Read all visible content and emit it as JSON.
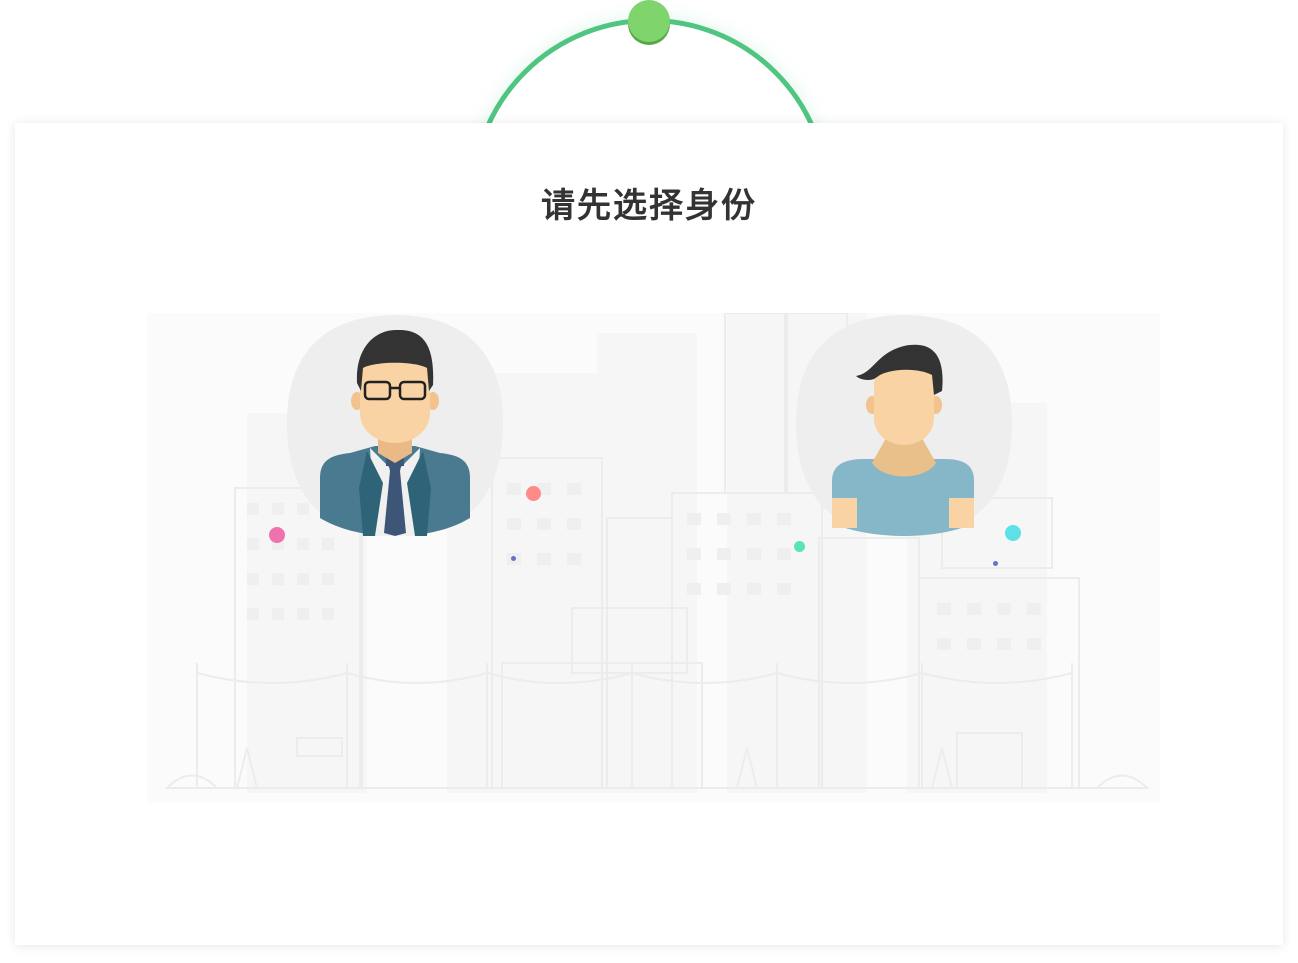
{
  "header": {
    "title": "请先选择身份"
  },
  "roles": [
    {
      "icon": "businessman-avatar-icon"
    },
    {
      "icon": "casual-man-avatar-icon"
    }
  ],
  "colors": {
    "accent_green": "#4fc581",
    "knob_green": "#7fd46c",
    "title_text": "#333333",
    "avatar_bg": "#eeeeee",
    "skin": "#f9d3a4",
    "hair": "#333333",
    "suit": "#4a7a90",
    "shirt_blue": "#86b7c8",
    "dot_pink": "#ef72ad",
    "dot_coral": "#ff8a8a",
    "dot_mint": "#59e4b7",
    "dot_cyan": "#5ee0e6",
    "dot_indigo": "#6a70c8"
  }
}
